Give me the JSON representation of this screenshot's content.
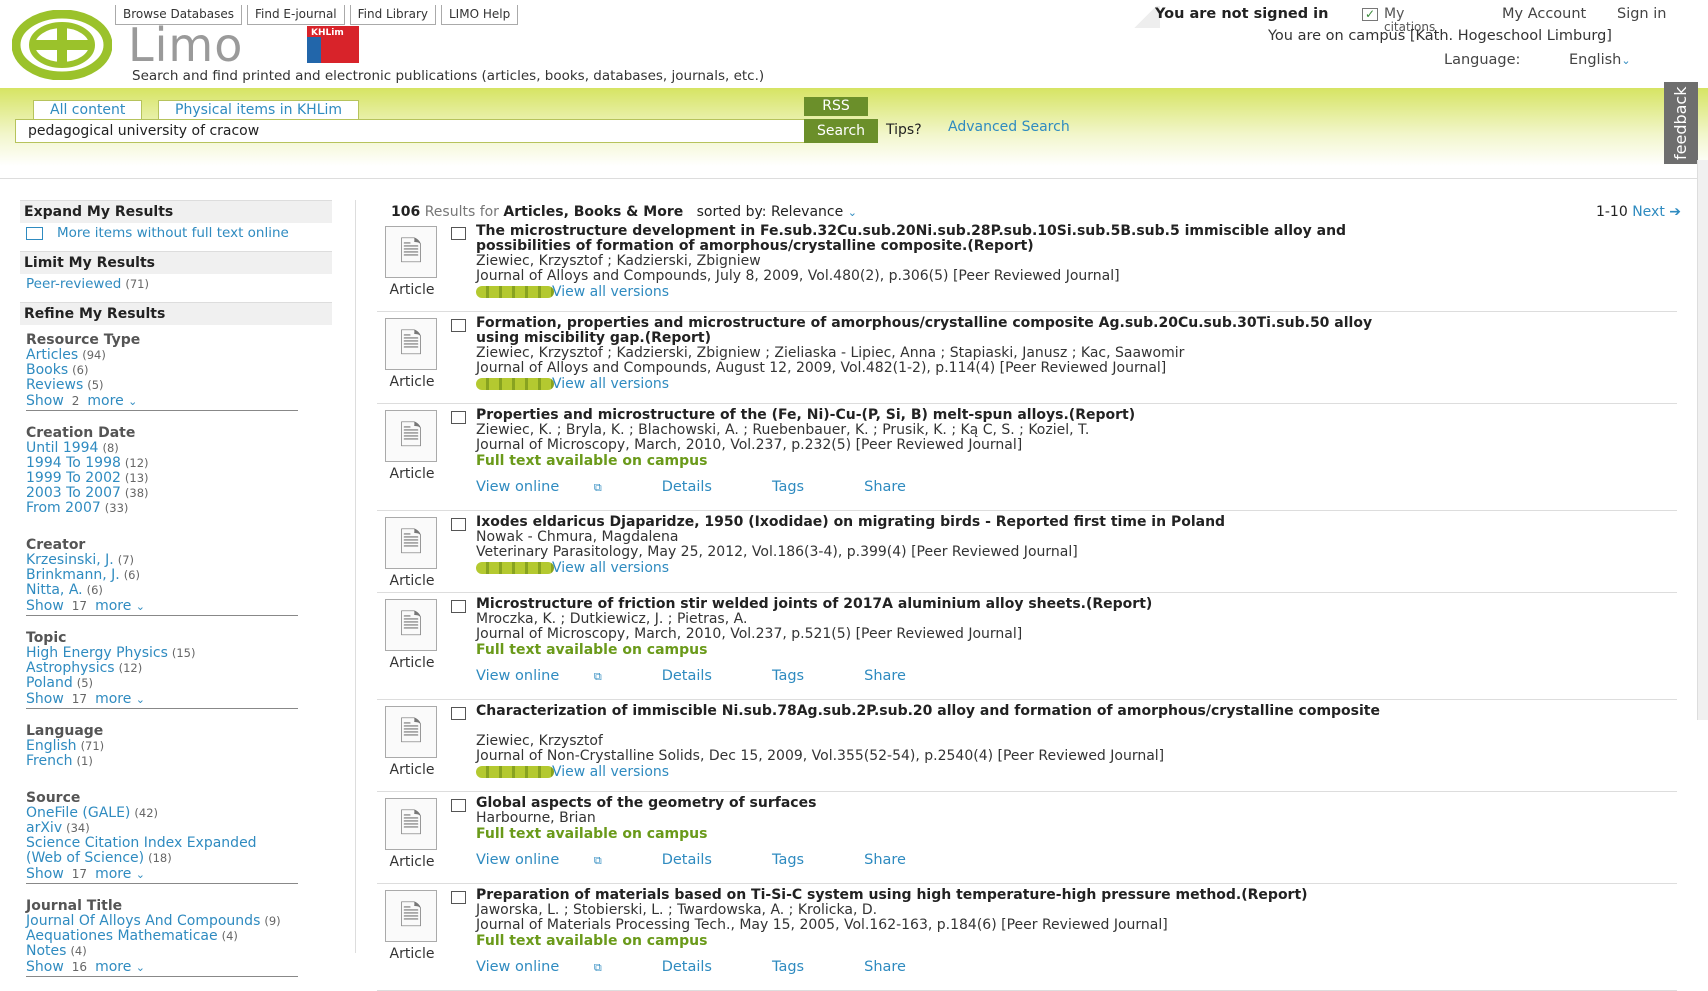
{
  "header": {
    "logo_text": "Limo",
    "institution_badge": "KHLim",
    "top_links": [
      "Browse Databases",
      "Find E-journal",
      "Find Library",
      "LIMO Help"
    ],
    "tagline": "Search and find printed and electronic publications (articles, books, databases, journals, etc.)",
    "not_signed_in": "You are not signed in",
    "my_citations": "My",
    "my_citations_sub": "citations",
    "my_account": "My Account",
    "sign_in": "Sign in",
    "campus_text": "You are on campus [Kath. Hogeschool Limburg]",
    "language_label": "Language:",
    "language_value": "English"
  },
  "search": {
    "tabs": [
      "All content",
      "Physical items in KHLim"
    ],
    "rss": "RSS",
    "query": "pedagogical university of cracow",
    "search_label": "Search",
    "tips": "Tips?",
    "advanced": "Advanced Search",
    "feedback": "feedback"
  },
  "sidebar": {
    "expand_title": "Expand My Results",
    "expand_item": "More items without full text online",
    "limit_title": "Limit My Results",
    "limit_item": "Peer-reviewed",
    "limit_count": "(71)",
    "refine_title": "Refine My Results",
    "groups": [
      {
        "title": "Resource Type",
        "items": [
          {
            "label": "Articles",
            "count": "(94)"
          },
          {
            "label": "Books",
            "count": "(6)"
          },
          {
            "label": "Reviews",
            "count": "(5)"
          }
        ],
        "show": "Show",
        "n": "2",
        "more": "more"
      },
      {
        "title": "Creation Date",
        "items": [
          {
            "label": "Until 1994",
            "count": "(8)"
          },
          {
            "label": "1994 To 1998",
            "count": "(12)"
          },
          {
            "label": "1999 To 2002",
            "count": "(13)"
          },
          {
            "label": "2003 To 2007",
            "count": "(38)"
          },
          {
            "label": "From 2007",
            "count": "(33)"
          }
        ],
        "show": "",
        "n": "",
        "more": ""
      },
      {
        "title": "Creator",
        "items": [
          {
            "label": "Krzesinski, J.",
            "count": "(7)"
          },
          {
            "label": "Brinkmann, J.",
            "count": "(6)"
          },
          {
            "label": "Nitta, A.",
            "count": "(6)"
          }
        ],
        "show": "Show",
        "n": "17",
        "more": "more"
      },
      {
        "title": "Topic",
        "items": [
          {
            "label": "High Energy Physics",
            "count": "(15)"
          },
          {
            "label": "Astrophysics",
            "count": "(12)"
          },
          {
            "label": "Poland",
            "count": "(5)"
          }
        ],
        "show": "Show",
        "n": "17",
        "more": "more"
      },
      {
        "title": "Language",
        "items": [
          {
            "label": "English",
            "count": "(71)"
          },
          {
            "label": "French",
            "count": "(1)"
          }
        ],
        "show": "",
        "n": "",
        "more": ""
      },
      {
        "title": "Source",
        "items": [
          {
            "label": "OneFile (GALE)",
            "count": "(42)"
          },
          {
            "label": "arXiv",
            "count": "(34)"
          },
          {
            "label": "Science Citation Index Expanded",
            "count": ""
          },
          {
            "label": "(Web of Science)",
            "count": "(18)"
          }
        ],
        "show": "Show",
        "n": "17",
        "more": "more"
      },
      {
        "title": "Journal Title",
        "items": [
          {
            "label": "Journal Of Alloys And Compounds",
            "count": "(9)"
          },
          {
            "label": "Aequationes Mathematicae",
            "count": "(4)"
          },
          {
            "label": "Notes",
            "count": "(4)"
          }
        ],
        "show": "Show",
        "n": "16",
        "more": "more"
      }
    ]
  },
  "results_header": {
    "count": "106",
    "results_for": "Results for",
    "scope": "Articles, Books & More",
    "sorted_by": "sorted by:",
    "sort": "Relevance",
    "range": "1-10",
    "next": "Next"
  },
  "results": [
    {
      "type": "Article",
      "title": "The microstructure development in Fe.sub.32Cu.sub.20Ni.sub.28P.sub.10Si.sub.5B.sub.5 immiscible alloy and possibilities of formation of amorphous/crystalline composite.(Report)",
      "authors": "Ziewiec, Krzysztof ; Kadzierski, Zbigniew",
      "source": "Journal of Alloys and Compounds, July 8, 2009, Vol.480(2), p.306(5) [Peer Reviewed Journal]",
      "versions": "View all versions",
      "fulltext": "",
      "actions": []
    },
    {
      "type": "Article",
      "title": "Formation, properties and microstructure of amorphous/crystalline composite Ag.sub.20Cu.sub.30Ti.sub.50 alloy using miscibility gap.(Report)",
      "authors": "Ziewiec, Krzysztof ; Kadzierski, Zbigniew ; Zieliaska - Lipiec, Anna ; Stapiaski, Janusz ; Kac, Saawomir",
      "source": "Journal of Alloys and Compounds, August 12, 2009, Vol.482(1-2), p.114(4) [Peer Reviewed Journal]",
      "versions": "View all versions",
      "fulltext": "",
      "actions": []
    },
    {
      "type": "Article",
      "title": "Properties and microstructure of the (Fe, Ni)-Cu-(P, Si, B) melt-spun alloys.(Report)",
      "authors": "Ziewiec, K. ; Bryla, K. ; Blachowski, A. ; Ruebenbauer, K. ; Prusik, K. ; Ką C, S. ; Koziel, T.",
      "source": "Journal of Microscopy, March, 2010, Vol.237, p.232(5) [Peer Reviewed Journal]",
      "versions": "",
      "fulltext": "Full text available on campus",
      "actions": [
        "View online",
        "Details",
        "Tags",
        "Share"
      ]
    },
    {
      "type": "Article",
      "title": "Ixodes eldaricus Djaparidze, 1950 (Ixodidae) on migrating birds - Reported first time in Poland",
      "authors": "Nowak - Chmura, Magdalena",
      "source": "Veterinary Parasitology, May 25, 2012, Vol.186(3-4), p.399(4) [Peer Reviewed Journal]",
      "versions": "View all versions",
      "fulltext": "",
      "actions": []
    },
    {
      "type": "Article",
      "title": "Microstructure of friction stir welded joints of 2017A aluminium alloy sheets.(Report)",
      "authors": "Mroczka, K. ; Dutkiewicz, J. ; Pietras, A.",
      "source": "Journal of Microscopy, March, 2010, Vol.237, p.521(5) [Peer Reviewed Journal]",
      "versions": "",
      "fulltext": "Full text available on campus",
      "actions": [
        "View online",
        "Details",
        "Tags",
        "Share"
      ]
    },
    {
      "type": "Article",
      "title": "Characterization of immiscible Ni.sub.78Ag.sub.2P.sub.20 alloy and formation of amorphous/crystalline composite",
      "authors": "Ziewiec, Krzysztof",
      "source": "Journal of Non-Crystalline Solids, Dec 15, 2009, Vol.355(52-54), p.2540(4) [Peer Reviewed Journal]",
      "versions": "View all versions",
      "fulltext": "",
      "actions": []
    },
    {
      "type": "Article",
      "title": "Global aspects of the geometry of surfaces",
      "authors": "Harbourne, Brian",
      "source": "",
      "versions": "",
      "fulltext": "Full text available on campus",
      "actions": [
        "View online",
        "Details",
        "Tags",
        "Share"
      ]
    },
    {
      "type": "Article",
      "title": "Preparation of materials based on Ti-Si-C system using high temperature-high pressure method.(Report)",
      "authors": "Jaworska, L. ; Stobierski, L. ; Twardowska, A. ; Krolicka, D.",
      "source": "Journal of Materials Processing Tech., May 15, 2005, Vol.162-163, p.184(6) [Peer Reviewed Journal]",
      "versions": "",
      "fulltext": "Full text available on campus",
      "actions": [
        "View online",
        "Details",
        "Tags",
        "Share"
      ]
    }
  ]
}
